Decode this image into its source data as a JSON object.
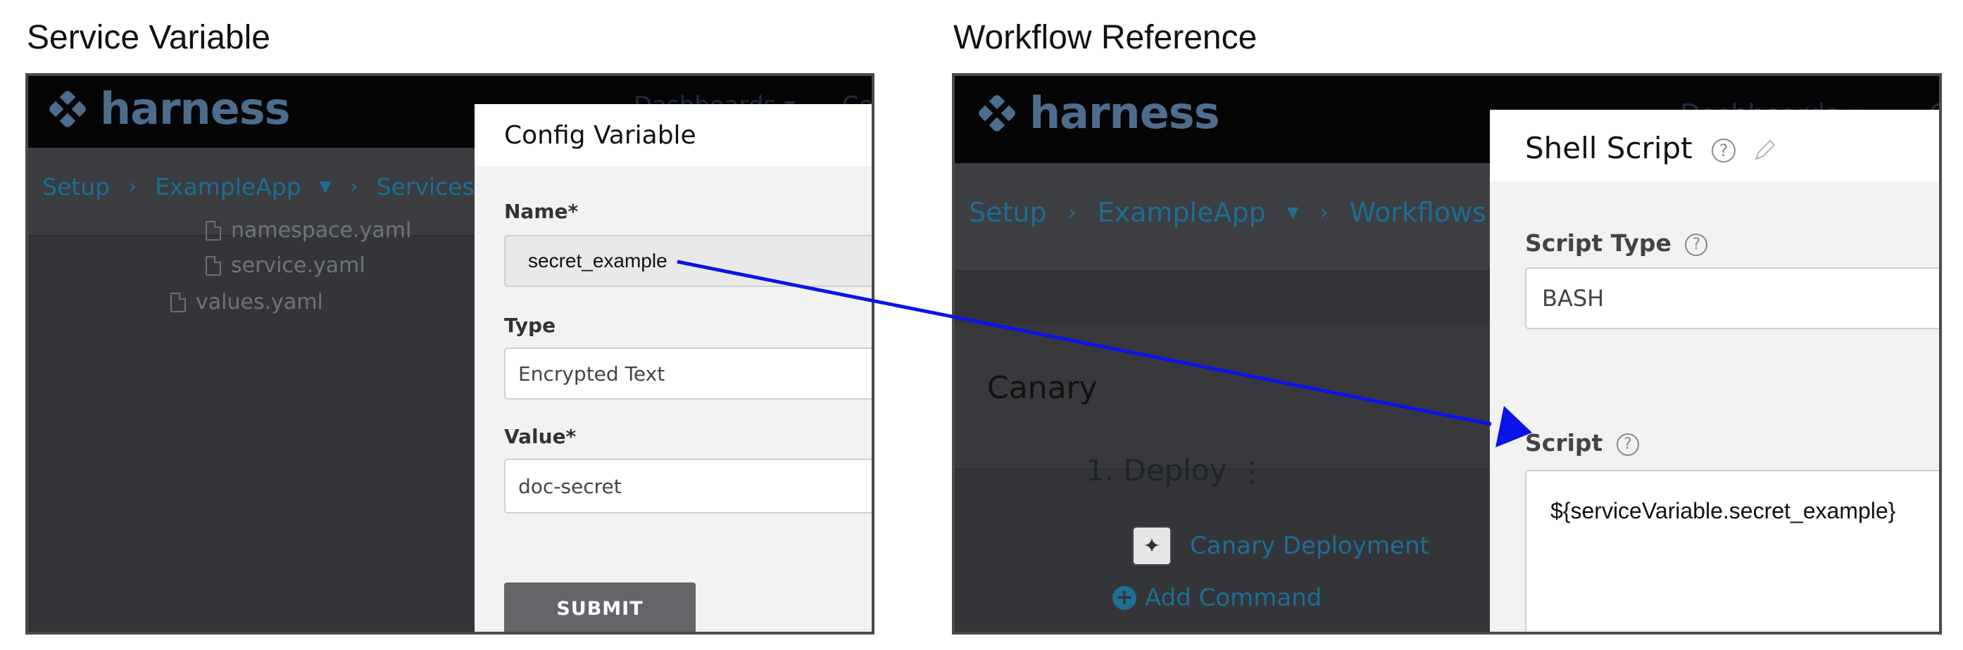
{
  "captions": {
    "left": "Service Variable",
    "right": "Workflow Reference"
  },
  "left_panel": {
    "logo_text": "harness",
    "topnav": [
      "Dashboards ▾",
      "Co"
    ],
    "breadcrumb": [
      "Setup",
      "ExampleApp",
      "Services"
    ],
    "tree": [
      "namespace.yaml",
      "service.yaml",
      "values.yaml"
    ],
    "modal": {
      "title": "Config Variable",
      "name_label": "Name*",
      "name_value": "secret_example",
      "type_label": "Type",
      "type_value": "Encrypted Text",
      "value_label": "Value*",
      "value_value": "doc-secret",
      "submit_label": "SUBMIT"
    }
  },
  "right_panel": {
    "logo_text": "harness",
    "topnav": [
      "Dashboards ▾",
      "C"
    ],
    "breadcrumb": [
      "Setup",
      "ExampleApp",
      "Workflows"
    ],
    "canary_title": "Canary",
    "deploy_title": "1. Deploy",
    "canary_step": "Canary Deployment",
    "add_command": "Add Command",
    "modal": {
      "title": "Shell Script",
      "script_type_label": "Script Type",
      "script_type_value": "BASH",
      "script_label": "Script",
      "script_value": "${serviceVariable.secret_example}"
    }
  },
  "colors": {
    "arrow": "#0a14e6",
    "link": "#1f6e93",
    "brand": "#4d6d8d"
  }
}
